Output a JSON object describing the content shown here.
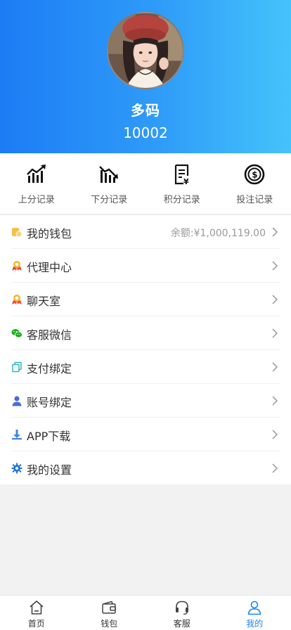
{
  "profile": {
    "nickname": "多码",
    "user_id": "10002"
  },
  "quick_actions": [
    {
      "label": "上分记录",
      "icon": "chart-up-icon"
    },
    {
      "label": "下分记录",
      "icon": "chart-down-icon"
    },
    {
      "label": "积分记录",
      "icon": "receipt-icon"
    },
    {
      "label": "投注记录",
      "icon": "coin-icon"
    }
  ],
  "menu": {
    "wallet": {
      "label": "我的钱包",
      "balance": "余额:¥1,000,119.00"
    },
    "agent": {
      "label": "代理中心"
    },
    "chat": {
      "label": "聊天室"
    },
    "wechat": {
      "label": "客服微信"
    },
    "payment": {
      "label": "支付绑定"
    },
    "account": {
      "label": "账号绑定"
    },
    "app": {
      "label": "APP下载"
    },
    "settings": {
      "label": "我的设置"
    }
  },
  "tabbar": [
    {
      "label": "首页",
      "icon": "home-icon",
      "active": false
    },
    {
      "label": "钱包",
      "icon": "wallet-icon",
      "active": false
    },
    {
      "label": "客服",
      "icon": "headset-icon",
      "active": false
    },
    {
      "label": "我的",
      "icon": "user-icon",
      "active": true
    }
  ],
  "colors": {
    "header_start": "#1c7cf4",
    "header_end": "#45c3fb",
    "active_tab": "#1c86e8"
  }
}
